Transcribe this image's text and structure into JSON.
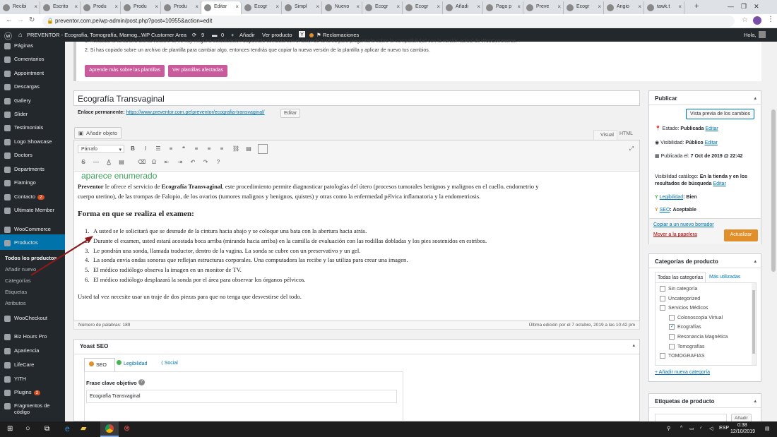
{
  "browser": {
    "tabs": [
      "Recibi",
      "Escrito",
      "Produ",
      "Produ",
      "Produ",
      "Editar",
      "Ecogr",
      "Simpl",
      "Nuevo",
      "Ecogr",
      "Ecogr",
      "Añadi",
      "Pago p",
      "Preve",
      "Ecogr",
      "Angio",
      "tawk.t"
    ],
    "active_tab_index": 5,
    "new_tab": "+",
    "url": "preventor.com.pe/wp-admin/post.php?post=10955&action=edit"
  },
  "adminbar": {
    "site": "PREVENTOR - Ecografía, Tomografía, Mamog...",
    "customer_area": "WP Customer Area",
    "updates": "9",
    "comments": "0",
    "add_new": "Añadir",
    "view_product": "Ver producto",
    "claims": "Reclamaciones",
    "greeting": "Hola,"
  },
  "sidebar": {
    "items": [
      "Páginas",
      "Comentarios",
      "Appointment",
      "Descargas",
      "Gallery",
      "Slider",
      "Testimonials",
      "Logo Showcase",
      "Doctors",
      "Departments",
      "Flamingo",
      "Contacto",
      "Ultimate Member",
      "WooCommerce",
      "Productos",
      "WooCheckout",
      "Biz Hours Pro",
      "Apariencia",
      "LifeCare",
      "YITH",
      "Plugins",
      "Fragmentos de código"
    ],
    "contacto_badge": "2",
    "plugins_badge": "2",
    "productos_sub": [
      "Todos los productos",
      "Añadir nuevo",
      "Categorías",
      "Etiquetas",
      "Atributos"
    ]
  },
  "notice": {
    "line1": "1. Actualiza tu tema a la última versión. Si no hay ninguna actualización disponible contacta con el autor de tu tema para preguntarle sobre la compatibilidad con la versión actual de WooCommerce.",
    "line2": "2. Si has copiado sobre un archivo de plantilla para cambiar algo, entonces tendrás que copiar la nueva versión de la plantilla y aplicar de nuevo tus cambios.",
    "btn_learn": "Aprende más sobre las plantillas",
    "btn_affected": "Ver plantillas afectadas"
  },
  "post": {
    "title": "Ecografía Transvaginal",
    "permalink_label": "Enlace permanente:",
    "permalink": "https://www.preventor.com.pe/preventor/ecografia-transvaginal/",
    "edit_btn": "Editar",
    "add_media": "Añadir objeto",
    "tab_visual": "Visual",
    "tab_html": "HTML",
    "format": "Párrafo",
    "annotation": "aparece enumerado",
    "intro_bold": "Preventor",
    "intro_1": " le ofrece el servicio de ",
    "intro_bold2": "Ecografía Transvaginal",
    "intro_2": ", este procedimiento permite diagnosticar patologías del útero (procesos tumorales benignos y malignos en el cuello, endometrio y",
    "intro_3": "cuerpo uterino), de las trompas de Falopio, de los ovarios (tumores malignos y benignos, quistes) y otras como la enfermedad pélvica inflamatoria y la endometriosis.",
    "heading": "Forma en que se realiza el examen:",
    "steps": [
      "A usted se le solicitará que se desnude de la cintura hacia abajo y se coloque una bata con la abertura hacia atrás.",
      "Durante el examen, usted estará acostada boca arriba (mirando hacia arriba) en la camilla de evaluación con las rodillas dobladas y los pies sostenidos en estribos.",
      "Le pondrán una sonda, llamada traductor, dentro de la vagina. La sonda se cubre con un preservativo y un gel.",
      "La sonda envía ondas sonoras que reflejan estructuras corporales. Una computadora las recibe y las utiliza para crear una imagen.",
      "El médico radiólogo observa la imagen en un monitor de TV.",
      "El médico radiólogo desplazará la sonda por el área para observar los órganos pélvicos."
    ],
    "footer_text": "Usted tal vez necesite usar un traje de dos piezas para que no tenga que desvestirse del todo.",
    "word_count": "Número de palabras: 189",
    "last_edit": "Última edición por el 7 octubre, 2019 a las 10:42 pm"
  },
  "yoast": {
    "title": "Yoast SEO",
    "tabs": [
      "SEO",
      "Legibilidad",
      "Social"
    ],
    "focus_label": "Frase clave objetivo",
    "focus_value": "Ecografía Transvaginal"
  },
  "publish": {
    "title": "Publicar",
    "preview": "Vista previa de los cambios",
    "status_label": "Estado:",
    "status": "Publicada",
    "visibility_label": "Visibilidad:",
    "visibility": "Público",
    "published_label": "Publicada el:",
    "published": "7 Oct de 2019 @ 22:42",
    "catalog_label": "Visibilidad catálogo:",
    "catalog": "En la tienda y en los",
    "catalog2": "resultados de búsqueda",
    "readability_label": "Legibilidad",
    "readability": ": Bien",
    "seo_label": "SEO",
    "seo": ": Aceptable",
    "edit": "Editar",
    "copy_draft": "Copiar a un nuevo borrador",
    "trash": "Mover a la papelera",
    "update": "Actualizar"
  },
  "categories": {
    "title": "Categorías de producto",
    "tab_all": "Todas las categorías",
    "tab_used": "Más utilizadas",
    "items": [
      {
        "label": "Sin categoría",
        "indent": 0,
        "checked": false
      },
      {
        "label": "Uncategorized",
        "indent": 0,
        "checked": false
      },
      {
        "label": "Servicios Médicos",
        "indent": 0,
        "checked": false
      },
      {
        "label": "Colonoscopia Virtual",
        "indent": 1,
        "checked": false
      },
      {
        "label": "Ecografías",
        "indent": 1,
        "checked": true
      },
      {
        "label": "Resonancia Magnética",
        "indent": 1,
        "checked": false
      },
      {
        "label": "Tomografías",
        "indent": 1,
        "checked": false
      },
      {
        "label": "TOMOGRAFIAS",
        "indent": 0,
        "checked": false
      }
    ],
    "add_new": "+ Añadir nueva categoría"
  },
  "tags": {
    "title": "Etiquetas de producto",
    "add_btn": "Añadir"
  },
  "taskbar": {
    "time": "0:38",
    "date": "12/10/2019"
  },
  "colors": {
    "wp_dark": "#23282d",
    "wp_blue": "#0073aa",
    "pink": "#c95a9b",
    "update_orange": "#e08f2a",
    "annotation_green": "#3ca55c"
  }
}
